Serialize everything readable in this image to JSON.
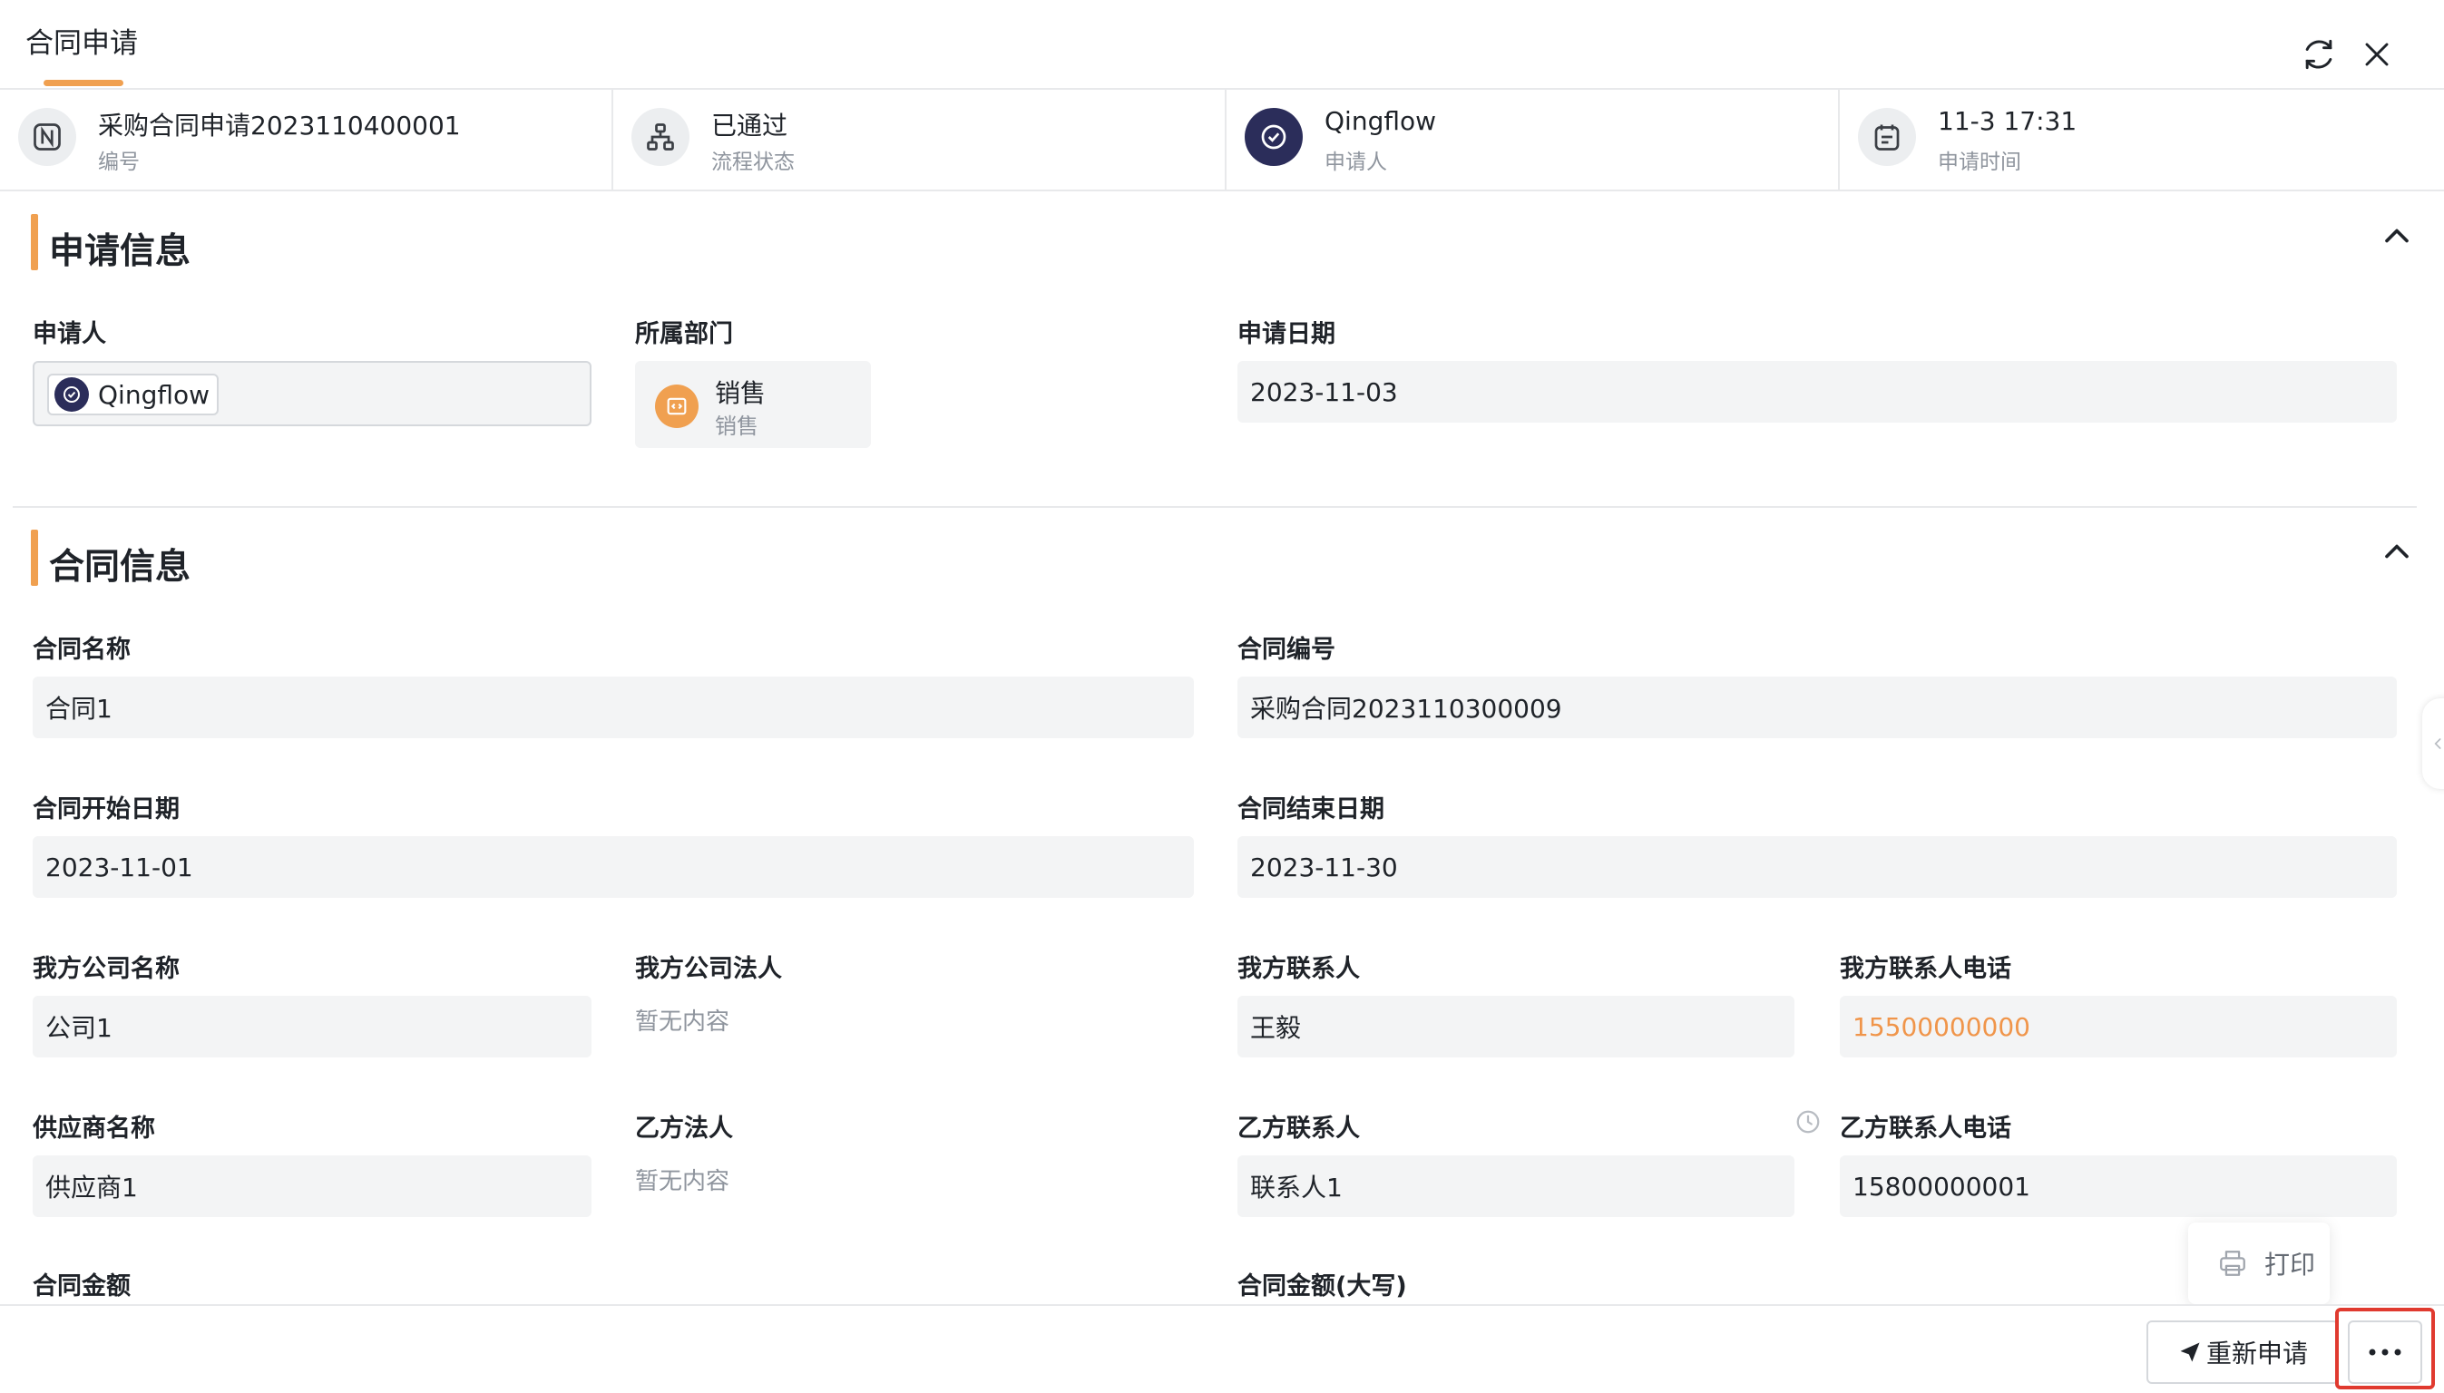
{
  "header": {
    "title": "合同申请"
  },
  "infobar": [
    {
      "value": "采购合同申请2023110400001",
      "label": "编号"
    },
    {
      "value": "已通过",
      "label": "流程状态"
    },
    {
      "value": "Qingflow",
      "label": "申请人"
    },
    {
      "value": "11-3 17:31",
      "label": "申请时间"
    }
  ],
  "sections": {
    "apply": {
      "title": "申请信息",
      "applicant_label": "申请人",
      "applicant_value": "Qingflow",
      "dept_label": "所属部门",
      "dept_name": "销售",
      "dept_sub": "销售",
      "date_label": "申请日期",
      "date_value": "2023-11-03"
    },
    "contract": {
      "title": "合同信息",
      "fields": {
        "name_label": "合同名称",
        "name_value": "合同1",
        "no_label": "合同编号",
        "no_value": "采购合同2023110300009",
        "start_label": "合同开始日期",
        "start_value": "2023-11-01",
        "end_label": "合同结束日期",
        "end_value": "2023-11-30",
        "our_company_label": "我方公司名称",
        "our_company_value": "公司1",
        "our_legal_label": "我方公司法人",
        "our_legal_value": "暂无内容",
        "our_contact_label": "我方联系人",
        "our_contact_value": "王毅",
        "our_phone_label": "我方联系人电话",
        "our_phone_value": "15500000000",
        "supplier_label": "供应商名称",
        "supplier_value": "供应商1",
        "b_legal_label": "乙方法人",
        "b_legal_value": "暂无内容",
        "b_contact_label": "乙方联系人",
        "b_contact_value": "联系人1",
        "b_phone_label": "乙方联系人电话",
        "b_phone_value": "15800000001",
        "amount_label": "合同金额",
        "amount_upper_label": "合同金额(大写)"
      }
    }
  },
  "footer": {
    "resubmit_label": "重新申请"
  },
  "popup": {
    "print_label": "打印"
  },
  "colors": {
    "accent": "#f0a050",
    "highlight": "#e03a2f",
    "phone_link": "#f0954a"
  },
  "icons": {
    "refresh": "refresh-icon",
    "close": "close-icon",
    "serial": "serial-number-icon",
    "flow": "flow-status-icon",
    "calendar": "calendar-icon",
    "collapse": "chevron-up-icon",
    "send": "send-icon",
    "more": "more-dots-icon",
    "print": "printer-icon",
    "clock": "clock-icon"
  }
}
